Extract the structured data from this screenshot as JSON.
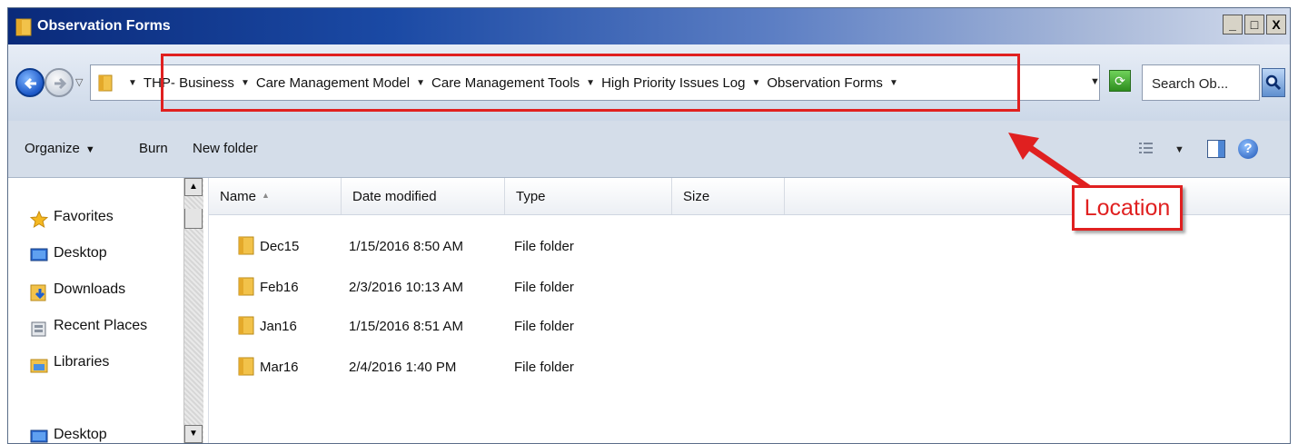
{
  "window": {
    "title": "Observation Forms"
  },
  "caption_buttons": [
    "_",
    "□",
    "X"
  ],
  "address": {
    "breadcrumbs": [
      "THP- Business",
      "Care Management Model",
      "Care Management Tools",
      "High Priority Issues Log",
      "Observation Forms"
    ]
  },
  "search": {
    "placeholder": "Search Ob..."
  },
  "toolbar": {
    "organize": "Organize",
    "burn": "Burn",
    "new_folder": "New folder"
  },
  "nav": {
    "items": [
      {
        "label": "Favorites",
        "icon": "star-icon"
      },
      {
        "label": "Desktop",
        "icon": "desktop-icon"
      },
      {
        "label": "Downloads",
        "icon": "downloads-icon"
      },
      {
        "label": "Recent Places",
        "icon": "recent-places-icon"
      },
      {
        "label": "Libraries",
        "icon": "libraries-icon"
      },
      {
        "label": "Desktop",
        "icon": "desktop-icon"
      }
    ]
  },
  "columns": [
    "Name",
    "Date modified",
    "Type",
    "Size"
  ],
  "files": [
    {
      "name": "Dec15",
      "date": "1/15/2016 8:50 AM",
      "type": "File folder"
    },
    {
      "name": "Feb16",
      "date": "2/3/2016 10:13 AM",
      "type": "File folder"
    },
    {
      "name": "Jan16",
      "date": "1/15/2016 8:51 AM",
      "type": "File folder"
    },
    {
      "name": "Mar16",
      "date": "2/4/2016 1:40 PM",
      "type": "File folder"
    }
  ],
  "annotation": {
    "label": "Location",
    "color": "#e02020"
  }
}
